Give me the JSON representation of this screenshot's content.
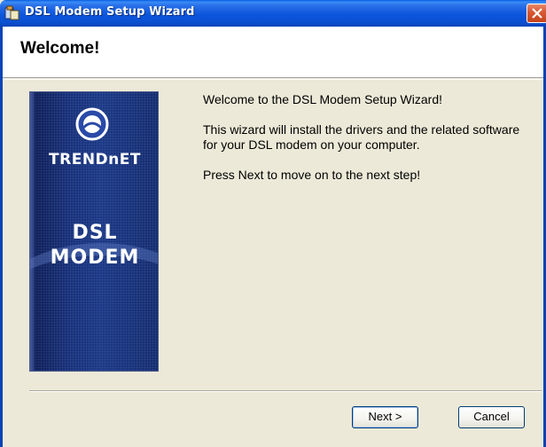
{
  "window": {
    "title": "DSL Modem Setup Wizard",
    "icon": "wizard-app-icon",
    "close_icon": "close-icon"
  },
  "header": {
    "title": "Welcome!"
  },
  "banner": {
    "brand": "TRENDnET",
    "product_line1": "DSL",
    "product_line2": "MODEM",
    "logo_icon": "trendnet-logo-icon"
  },
  "body": {
    "paragraph1": "Welcome to the DSL Modem Setup Wizard!",
    "paragraph2": "This wizard will install the drivers and the related software for your DSL modem on your computer.",
    "paragraph3": "Press Next to move on to the next step!"
  },
  "buttons": {
    "next_label": "Next >",
    "cancel_label": "Cancel"
  },
  "colors": {
    "titlebar": "#0c55dc",
    "dialog_bg": "#ece9d8",
    "close_button": "#d95a34",
    "banner_blue": "#17307a"
  }
}
